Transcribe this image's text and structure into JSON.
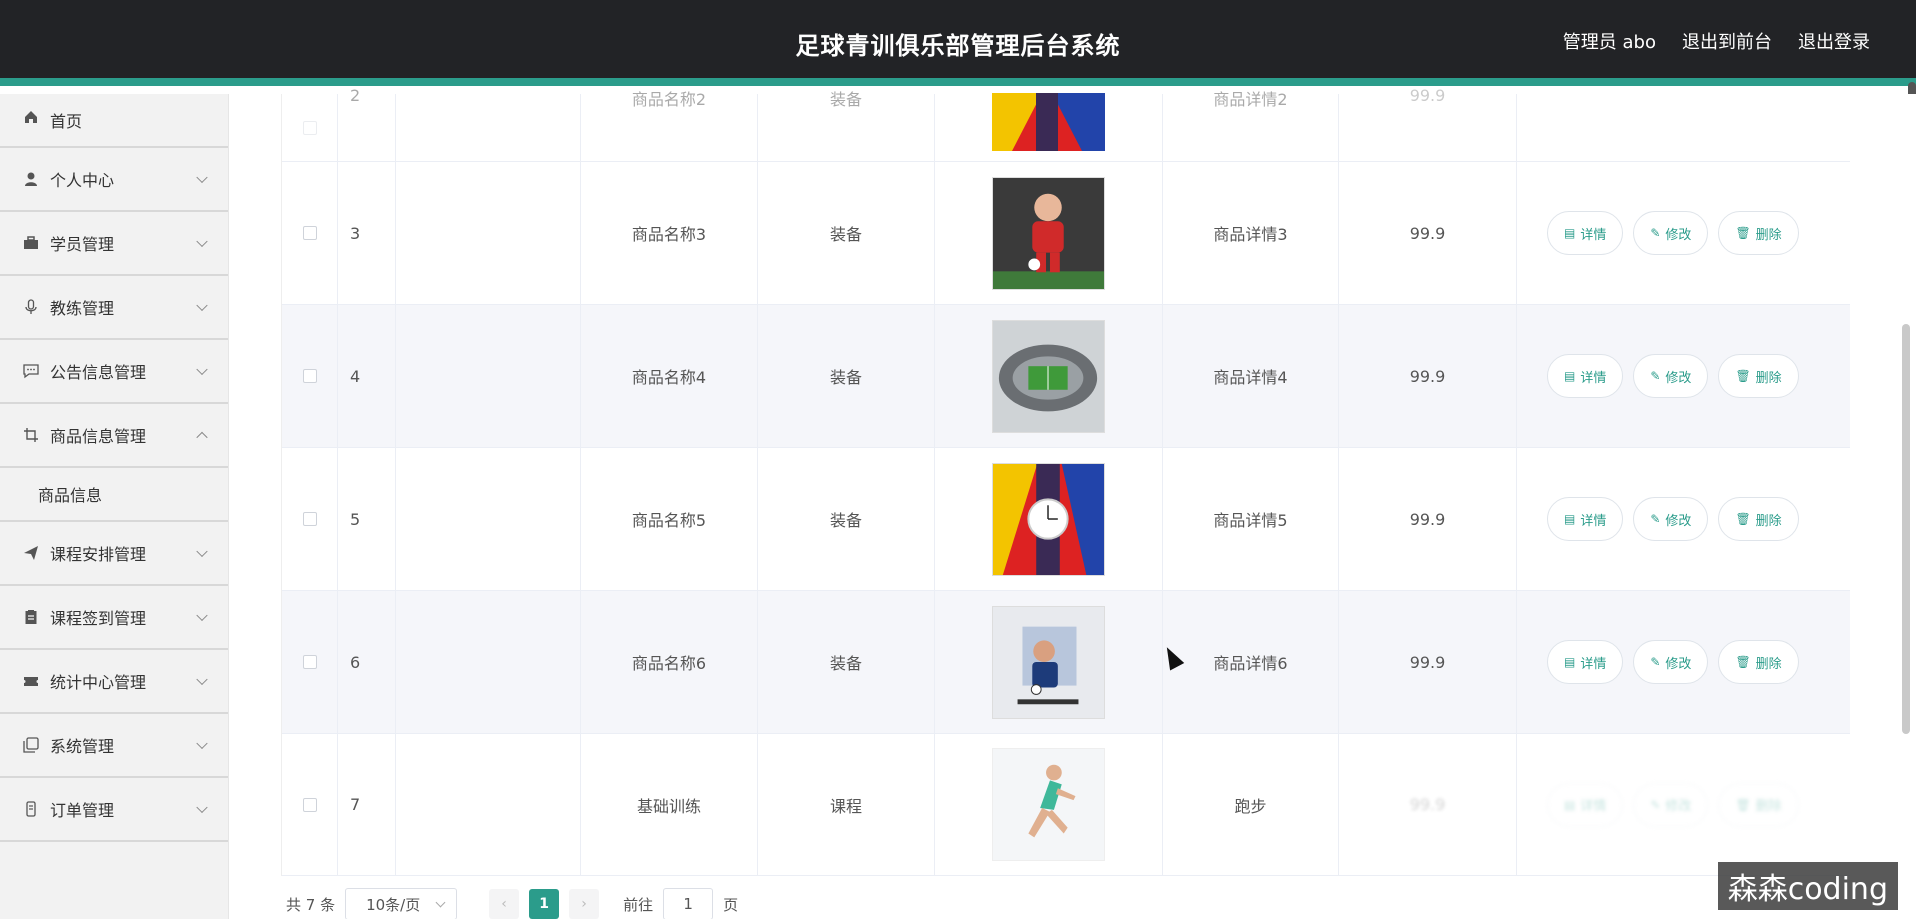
{
  "header": {
    "title": "足球青训俱乐部管理后台系统",
    "admin": "管理员 abo",
    "to_front": "退出到前台",
    "logout": "退出登录"
  },
  "sidebar": {
    "home": "首页",
    "items": [
      {
        "label": "个人中心",
        "icon": "user-icon"
      },
      {
        "label": "学员管理",
        "icon": "briefcase-icon"
      },
      {
        "label": "教练管理",
        "icon": "microphone-icon"
      },
      {
        "label": "公告信息管理",
        "icon": "chat-icon"
      },
      {
        "label": "商品信息管理",
        "icon": "crop-icon"
      },
      {
        "label": "课程安排管理",
        "icon": "send-icon"
      },
      {
        "label": "课程签到管理",
        "icon": "clipboard-icon"
      },
      {
        "label": "统计中心管理",
        "icon": "ticket-icon"
      },
      {
        "label": "系统管理",
        "icon": "copy-icon"
      },
      {
        "label": "订单管理",
        "icon": "device-icon"
      }
    ],
    "sub_item": "商品信息"
  },
  "table": {
    "partial_row": {
      "index": "2",
      "name": "商品名称2",
      "type": "装备",
      "detail": "商品详情2",
      "price": "99.9"
    },
    "rows": [
      {
        "index": "3",
        "name": "商品名称3",
        "type": "装备",
        "detail": "商品详情3",
        "price": "99.9"
      },
      {
        "index": "4",
        "name": "商品名称4",
        "type": "装备",
        "detail": "商品详情4",
        "price": "99.9"
      },
      {
        "index": "5",
        "name": "商品名称5",
        "type": "装备",
        "detail": "商品详情5",
        "price": "99.9"
      },
      {
        "index": "6",
        "name": "商品名称6",
        "type": "装备",
        "detail": "商品详情6",
        "price": "99.9"
      },
      {
        "index": "7",
        "name": "基础训练",
        "type": "课程",
        "detail": "跑步",
        "price": "99.9"
      }
    ],
    "actions": {
      "detail": "详情",
      "edit": "修改",
      "delete": "删除"
    }
  },
  "pagination": {
    "total": "共 7 条",
    "page_size": "10条/页",
    "current_page": "1",
    "goto_prefix": "前往",
    "goto_value": "1",
    "goto_suffix": "页"
  },
  "watermark": "森森coding",
  "colors": {
    "accent": "#2b9c8b",
    "header_bg": "#222326"
  }
}
